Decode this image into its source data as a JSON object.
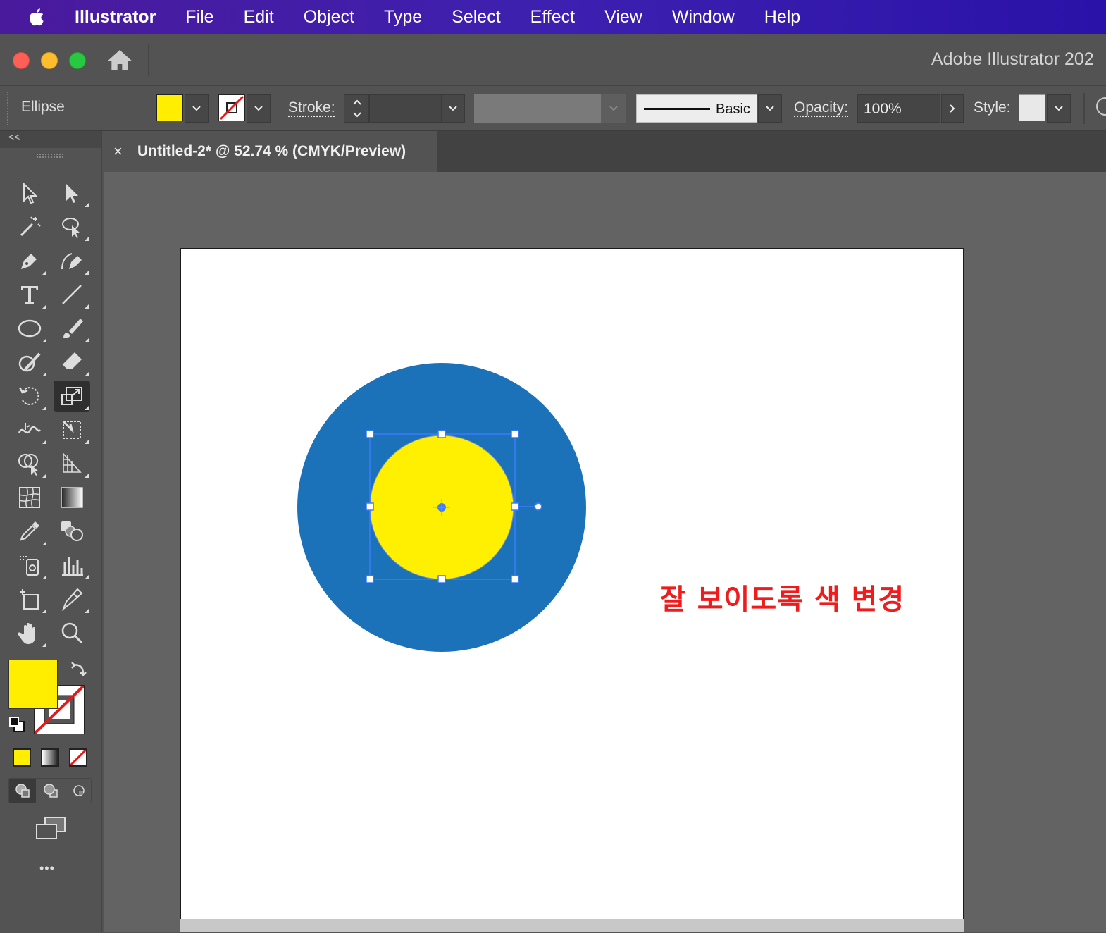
{
  "menubar": {
    "app": "Illustrator",
    "items": [
      "File",
      "Edit",
      "Object",
      "Type",
      "Select",
      "Effect",
      "View",
      "Window",
      "Help"
    ]
  },
  "window": {
    "title": "Adobe Illustrator 202"
  },
  "control_bar": {
    "tool_name": "Ellipse",
    "fill_color": "#ffee00",
    "stroke_color": "none",
    "stroke_label": "Stroke:",
    "stroke_value": "",
    "brush_profile": "Basic",
    "opacity_label": "Opacity:",
    "opacity_value": "100%",
    "style_label": "Style:"
  },
  "tools_panel": {
    "collapse_label": "<<",
    "more_label": "•••",
    "fill_color": "#ffee00",
    "stroke_color": "none",
    "active_tool": "scale-tool"
  },
  "document": {
    "tab_close": "×",
    "tab_title": "Untitled-2* @ 52.74 % (CMYK/Preview)"
  },
  "artwork": {
    "outer_circle_color": "#1b72b8",
    "inner_circle_color": "#ffef00",
    "selection_color": "#3d7bff",
    "annotation_text": "잘 보이도록 색 변경",
    "annotation_color": "#ee1c1c"
  }
}
